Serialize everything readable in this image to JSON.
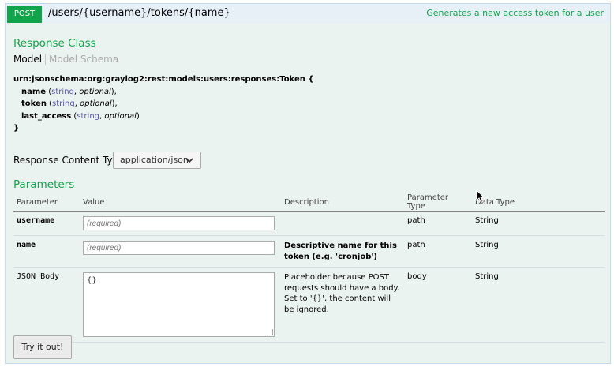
{
  "operation": {
    "method": "POST",
    "path": "/users/{username}/tokens/{name}",
    "summary": "Generates a new access token for a user"
  },
  "response_class": {
    "heading": "Response Class",
    "tabs": [
      "Model",
      "Model Schema"
    ],
    "active_tab": "Model",
    "signature": "urn:jsonschema:org:graylog2:rest:models:users:responses:Token {",
    "closing": "}",
    "properties": [
      {
        "name": "name",
        "type": "string",
        "optional": "optional"
      },
      {
        "name": "token",
        "type": "string",
        "optional": "optional"
      },
      {
        "name": "last_access",
        "type": "string",
        "optional": "optional"
      }
    ]
  },
  "response_content_type": {
    "label": "Response Content Type",
    "selected": "application/json"
  },
  "parameters": {
    "heading": "Parameters",
    "columns": [
      "Parameter",
      "Value",
      "Description",
      "Parameter Type",
      "Data Type"
    ],
    "rows": [
      {
        "name": "username",
        "placeholder": "(required)",
        "description": "",
        "param_type": "path",
        "data_type": "String"
      },
      {
        "name": "name",
        "placeholder": "(required)",
        "description": "Descriptive name for this token (e.g. 'cronjob')",
        "param_type": "path",
        "data_type": "String"
      },
      {
        "name": "JSON Body",
        "value": "{}",
        "description": "Placeholder because POST requests should have a body. Set to '{}', the content will be ignored.",
        "param_type": "body",
        "data_type": "String"
      }
    ]
  },
  "try_button": "Try it out!",
  "colors": {
    "accent": "#10a54a",
    "panel": "#ebf3f0",
    "header": "#e7f0f7"
  }
}
